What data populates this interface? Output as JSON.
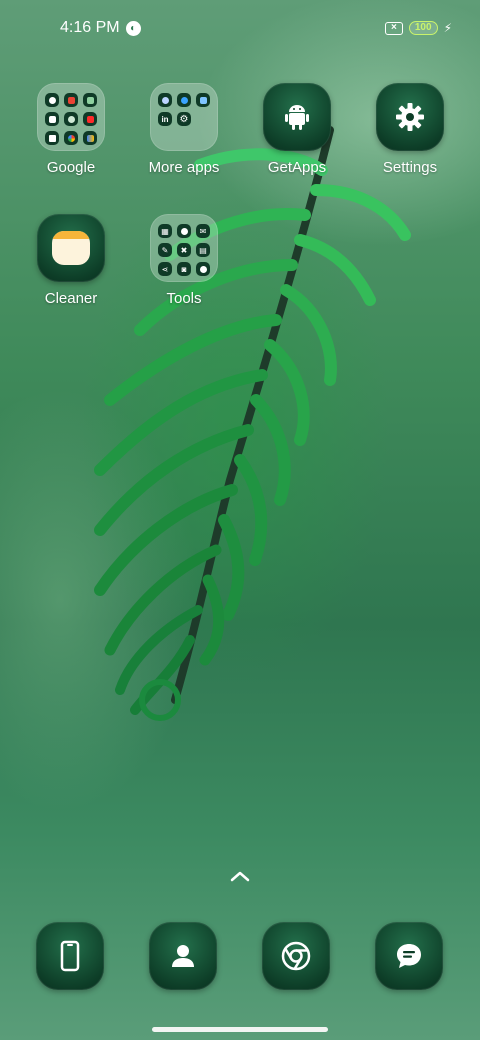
{
  "status_bar": {
    "time": "4:16 PM",
    "battery_level": "100",
    "icons": [
      "notification-icon",
      "no-sim-icon",
      "battery-icon",
      "charging-icon"
    ]
  },
  "home_apps": [
    {
      "label": "Google",
      "type": "folder"
    },
    {
      "label": "More apps",
      "type": "folder"
    },
    {
      "label": "GetApps",
      "type": "app",
      "icon": "android-icon"
    },
    {
      "label": "Settings",
      "type": "app",
      "icon": "gear-icon"
    },
    {
      "label": "Cleaner",
      "type": "app",
      "icon": "cleaner-icon"
    },
    {
      "label": "Tools",
      "type": "folder"
    }
  ],
  "dock": [
    {
      "icon": "phone-icon"
    },
    {
      "icon": "contacts-icon"
    },
    {
      "icon": "chrome-icon"
    },
    {
      "icon": "messages-icon"
    }
  ],
  "colors": {
    "battery_accent": "#c9f36b",
    "icon_tile": "#0d3d27",
    "wallpaper_green": "#3f8a5a"
  }
}
